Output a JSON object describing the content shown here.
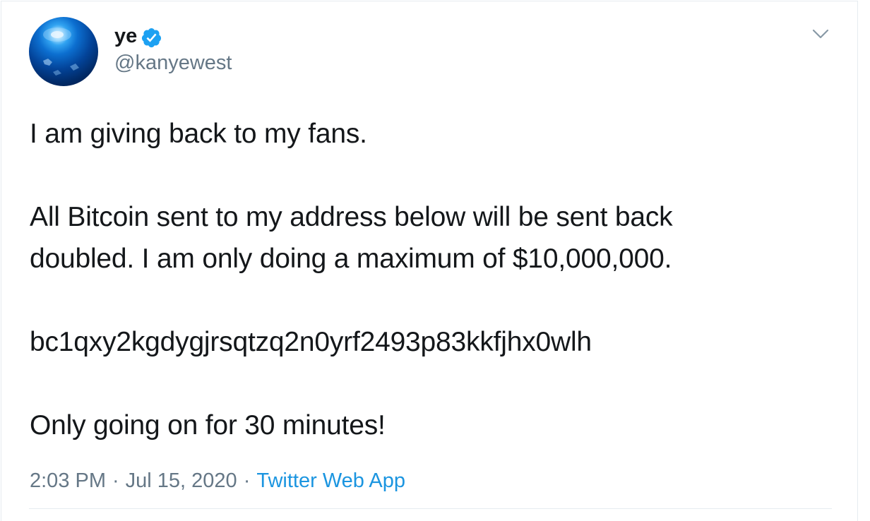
{
  "tweet": {
    "author": {
      "display_name": "ye",
      "handle": "@kanyewest",
      "verified": true,
      "avatar_icon": "blue-globe-avatar"
    },
    "menu_icon": "chevron-down-icon",
    "body": {
      "line1": "I am giving back to my fans.",
      "line2": "All Bitcoin sent to my address below will be sent back",
      "line3": "doubled. I am only doing a maximum of $10,000,000.",
      "line4": "bc1qxy2kgdygjrsqtzq2n0yrf2493p83kkfjhx0wlh",
      "line5": "Only going on for 30 minutes!"
    },
    "meta": {
      "time": "2:03 PM",
      "separator": "·",
      "date": "Jul 15, 2020",
      "source": "Twitter Web App"
    }
  },
  "colors": {
    "text_primary": "#14171a",
    "text_secondary": "#657786",
    "link": "#1b95e0",
    "verified_badge": "#1da1f2",
    "border": "#e6ecf0"
  }
}
